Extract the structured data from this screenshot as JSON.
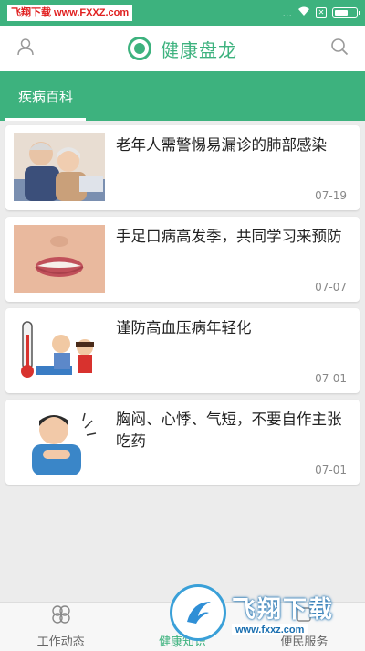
{
  "status_bar": {
    "watermark_text": "飞翔下载 www.FXXZ.com",
    "dots": "...",
    "sim_label": "✕"
  },
  "header": {
    "title": "健康盘龙",
    "user_icon": "user-icon",
    "search_icon": "search-icon"
  },
  "tabs": [
    {
      "label": "疾病百科",
      "active": true
    }
  ],
  "articles": [
    {
      "title": "老年人需警惕易漏诊的肺部感染",
      "date": "07-19",
      "thumb": "elderly-couple-photo"
    },
    {
      "title": "手足口病高发季，共同学习来预防",
      "date": "07-07",
      "thumb": "mouth-closeup-photo"
    },
    {
      "title": "谨防高血压病年轻化",
      "date": "07-01",
      "thumb": "blood-pressure-illustration"
    },
    {
      "title": "胸闷、心悸、气短，不要自作主张吃药",
      "date": "07-01",
      "thumb": "chest-pain-illustration"
    }
  ],
  "bottom_nav": [
    {
      "label": "工作动态",
      "icon": "clover-icon",
      "active": false
    },
    {
      "label": "健康知识",
      "icon": "health-icon",
      "active": true
    },
    {
      "label": "便民服务",
      "icon": "service-icon",
      "active": false
    }
  ],
  "watermark": {
    "main": "飞翔下载",
    "sub": "www.fxxz.com"
  },
  "colors": {
    "primary": "#3db27e",
    "background": "#ececec",
    "card": "#ffffff"
  }
}
